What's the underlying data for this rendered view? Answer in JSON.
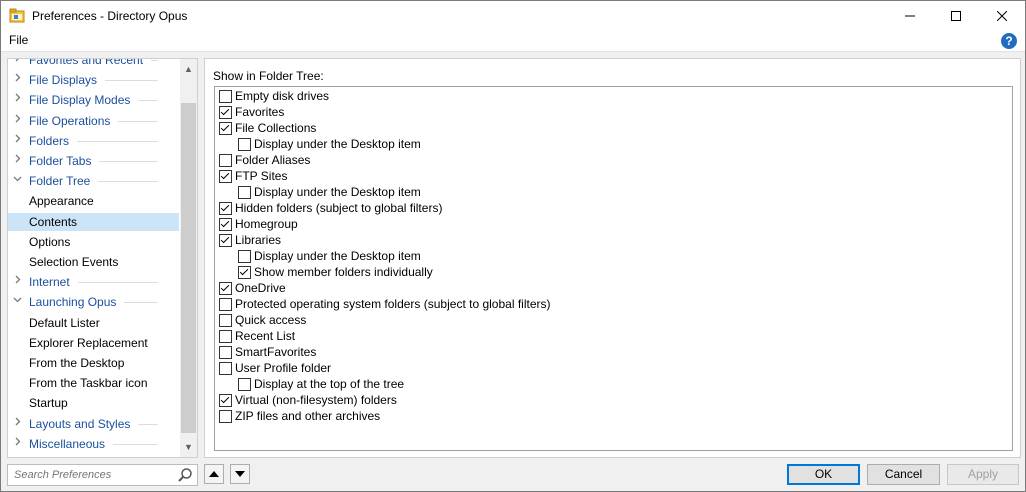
{
  "window": {
    "title": "Preferences - Directory Opus"
  },
  "menu": {
    "file_label": "File",
    "help_glyph": "?"
  },
  "sidebar": {
    "items": [
      {
        "label": "Favorites and Recent",
        "type": "category",
        "expanded": false
      },
      {
        "label": "File Displays",
        "type": "category",
        "expanded": false
      },
      {
        "label": "File Display Modes",
        "type": "category",
        "expanded": false
      },
      {
        "label": "File Operations",
        "type": "category",
        "expanded": false
      },
      {
        "label": "Folders",
        "type": "category",
        "expanded": false
      },
      {
        "label": "Folder Tabs",
        "type": "category",
        "expanded": false
      },
      {
        "label": "Folder Tree",
        "type": "category",
        "expanded": true
      },
      {
        "label": "Appearance",
        "type": "sub"
      },
      {
        "label": "Contents",
        "type": "sub",
        "selected": true
      },
      {
        "label": "Options",
        "type": "sub"
      },
      {
        "label": "Selection Events",
        "type": "sub"
      },
      {
        "label": "Internet",
        "type": "category",
        "expanded": false
      },
      {
        "label": "Launching Opus",
        "type": "category",
        "expanded": true
      },
      {
        "label": "Default Lister",
        "type": "sub"
      },
      {
        "label": "Explorer Replacement",
        "type": "sub"
      },
      {
        "label": "From the Desktop",
        "type": "sub"
      },
      {
        "label": "From the Taskbar icon",
        "type": "sub"
      },
      {
        "label": "Startup",
        "type": "sub"
      },
      {
        "label": "Layouts and Styles",
        "type": "category",
        "expanded": false
      },
      {
        "label": "Miscellaneous",
        "type": "category",
        "expanded": false
      }
    ]
  },
  "content": {
    "section_label": "Show in Folder Tree:",
    "options": [
      {
        "label": "Empty disk drives",
        "checked": false,
        "indent": 0
      },
      {
        "label": "Favorites",
        "checked": true,
        "indent": 0
      },
      {
        "label": "File Collections",
        "checked": true,
        "indent": 0
      },
      {
        "label": "Display under the Desktop item",
        "checked": false,
        "indent": 1
      },
      {
        "label": "Folder Aliases",
        "checked": false,
        "indent": 0
      },
      {
        "label": "FTP Sites",
        "checked": true,
        "indent": 0
      },
      {
        "label": "Display under the Desktop item",
        "checked": false,
        "indent": 1
      },
      {
        "label": "Hidden folders (subject to global filters)",
        "checked": true,
        "indent": 0
      },
      {
        "label": "Homegroup",
        "checked": true,
        "indent": 0
      },
      {
        "label": "Libraries",
        "checked": true,
        "indent": 0
      },
      {
        "label": "Display under the Desktop item",
        "checked": false,
        "indent": 1
      },
      {
        "label": "Show member folders individually",
        "checked": true,
        "indent": 1
      },
      {
        "label": "OneDrive",
        "checked": true,
        "indent": 0
      },
      {
        "label": "Protected operating system folders (subject to global filters)",
        "checked": false,
        "indent": 0
      },
      {
        "label": "Quick access",
        "checked": false,
        "indent": 0
      },
      {
        "label": "Recent List",
        "checked": false,
        "indent": 0
      },
      {
        "label": "SmartFavorites",
        "checked": false,
        "indent": 0
      },
      {
        "label": "User Profile folder",
        "checked": false,
        "indent": 0
      },
      {
        "label": "Display at the top of the tree",
        "checked": false,
        "indent": 1
      },
      {
        "label": "Virtual (non-filesystem) folders",
        "checked": true,
        "indent": 0
      },
      {
        "label": "ZIP files and other archives",
        "checked": false,
        "indent": 0
      }
    ]
  },
  "search": {
    "placeholder": "Search Preferences"
  },
  "buttons": {
    "ok": "OK",
    "cancel": "Cancel",
    "apply": "Apply"
  },
  "colors": {
    "accent": "#0078d7",
    "selection": "#cce4f7",
    "category_text": "#1a4f9e"
  }
}
